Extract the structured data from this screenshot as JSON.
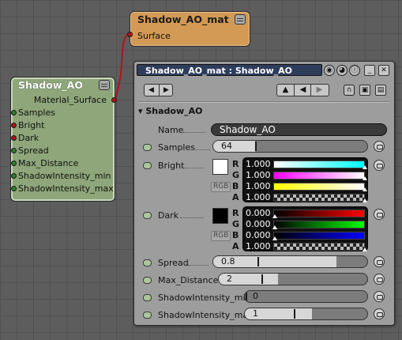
{
  "nodes": {
    "mat": {
      "title": "Shadow_AO_mat",
      "input_port": "Surface"
    },
    "ao": {
      "title": "Shadow_AO",
      "output_port": "Material_Surface",
      "inputs": [
        "Samples",
        "Bright",
        "Dark",
        "Spread",
        "Max_Distance",
        "ShadowIntensity_min",
        "ShadowIntensity_max"
      ]
    }
  },
  "panel": {
    "title": "Shadow_AO_mat : Shadow_AO",
    "section": "Shadow_AO",
    "name_label": "Name",
    "name_value": "Shadow_AO",
    "params": {
      "samples": {
        "label": "Samples",
        "value": "64",
        "fill": 0.27
      },
      "bright": {
        "label": "Bright"
      },
      "dark": {
        "label": "Dark"
      },
      "spread": {
        "label": "Spread",
        "value": "0.8",
        "fill": 0.8
      },
      "max_distance": {
        "label": "Max_Distance",
        "value": "2",
        "fill": 0.4
      },
      "intensity_min": {
        "label": "ShadowIntensity_min",
        "value": "0",
        "fill": 0.0
      },
      "intensity_max": {
        "label": "ShadowIntensity_max",
        "value": "1",
        "fill": 0.55
      }
    },
    "rgb_button": "RGB",
    "bright_channels": [
      {
        "ch": "R",
        "value": "1.000"
      },
      {
        "ch": "G",
        "value": "1.000"
      },
      {
        "ch": "B",
        "value": "1.000"
      },
      {
        "ch": "A",
        "value": "1.000"
      }
    ],
    "dark_channels": [
      {
        "ch": "R",
        "value": "0.000"
      },
      {
        "ch": "G",
        "value": "0.000"
      },
      {
        "ch": "B",
        "value": "0.000"
      },
      {
        "ch": "A",
        "value": "1.000"
      }
    ]
  },
  "colors": {
    "mat_node": "#d39a55",
    "ao_node": "#8ea67a",
    "wire": "#b0141a",
    "panel_title_bg": "#2e3d5c",
    "bright_swatch": "#ffffff",
    "dark_swatch": "#000000"
  },
  "icons": [
    "menu-icon",
    "chevron-left-icon",
    "chevron-right-icon",
    "up-arrow-icon",
    "left-arrow-icon",
    "right-arrow-icon",
    "close-icon",
    "pin-icon",
    "link-icon"
  ]
}
